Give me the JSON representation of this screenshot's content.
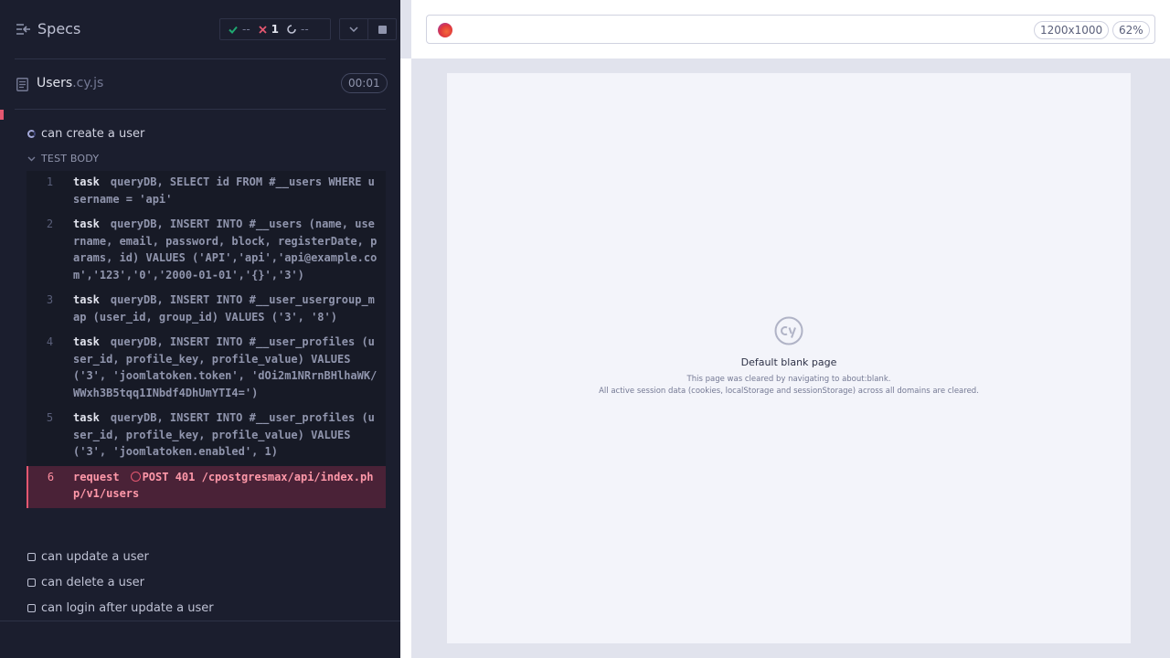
{
  "reporter": {
    "specs_label": "Specs",
    "stats": {
      "passed": "--",
      "failed": "1",
      "pending": "--"
    },
    "spec": {
      "name": "Users",
      "ext": ".cy.js",
      "duration": "00:01"
    },
    "current_test": "can create a user",
    "body_label": "TEST BODY",
    "commands": [
      {
        "num": "1",
        "name": "task",
        "message": "queryDB, SELECT id FROM #__users WHERE username = 'api'"
      },
      {
        "num": "2",
        "name": "task",
        "message": "queryDB, INSERT INTO #__users (name, username, email, password, block, registerDate, params, id) VALUES ('API','api','api@example.com','123','0','2000-01-01','{}','3')"
      },
      {
        "num": "3",
        "name": "task",
        "message": "queryDB, INSERT INTO #__user_usergroup_map (user_id, group_id) VALUES ('3', '8')"
      },
      {
        "num": "4",
        "name": "task",
        "message": "queryDB, INSERT INTO #__user_profiles (user_id, profile_key, profile_value) VALUES ('3', 'joomlatoken.token', 'dOi2m1NRrnBHlhaWK/WWxh3B5tqq1INbdf4DhUmYTI4=')"
      },
      {
        "num": "5",
        "name": "task",
        "message": "queryDB, INSERT INTO #__user_profiles (user_id, profile_key, profile_value) VALUES ('3', 'joomlatoken.enabled', 1)"
      }
    ],
    "error_command": {
      "num": "6",
      "name": "request",
      "message": "POST 401 /cpostgresmax/api/index.php/v1/users"
    },
    "pending_tests": [
      "can update a user",
      "can delete a user",
      "can login after update a user"
    ]
  },
  "aut": {
    "viewport": "1200x1000",
    "zoom": "62%",
    "blank_title": "Default blank page",
    "blank_line1": "This page was cleared by navigating to about:blank.",
    "blank_line2": "All active session data (cookies, localStorage and sessionStorage) across all domains are cleared."
  },
  "colors": {
    "fail": "#e45770",
    "pass": "#1fa971",
    "bg": "#1b1e2e"
  }
}
